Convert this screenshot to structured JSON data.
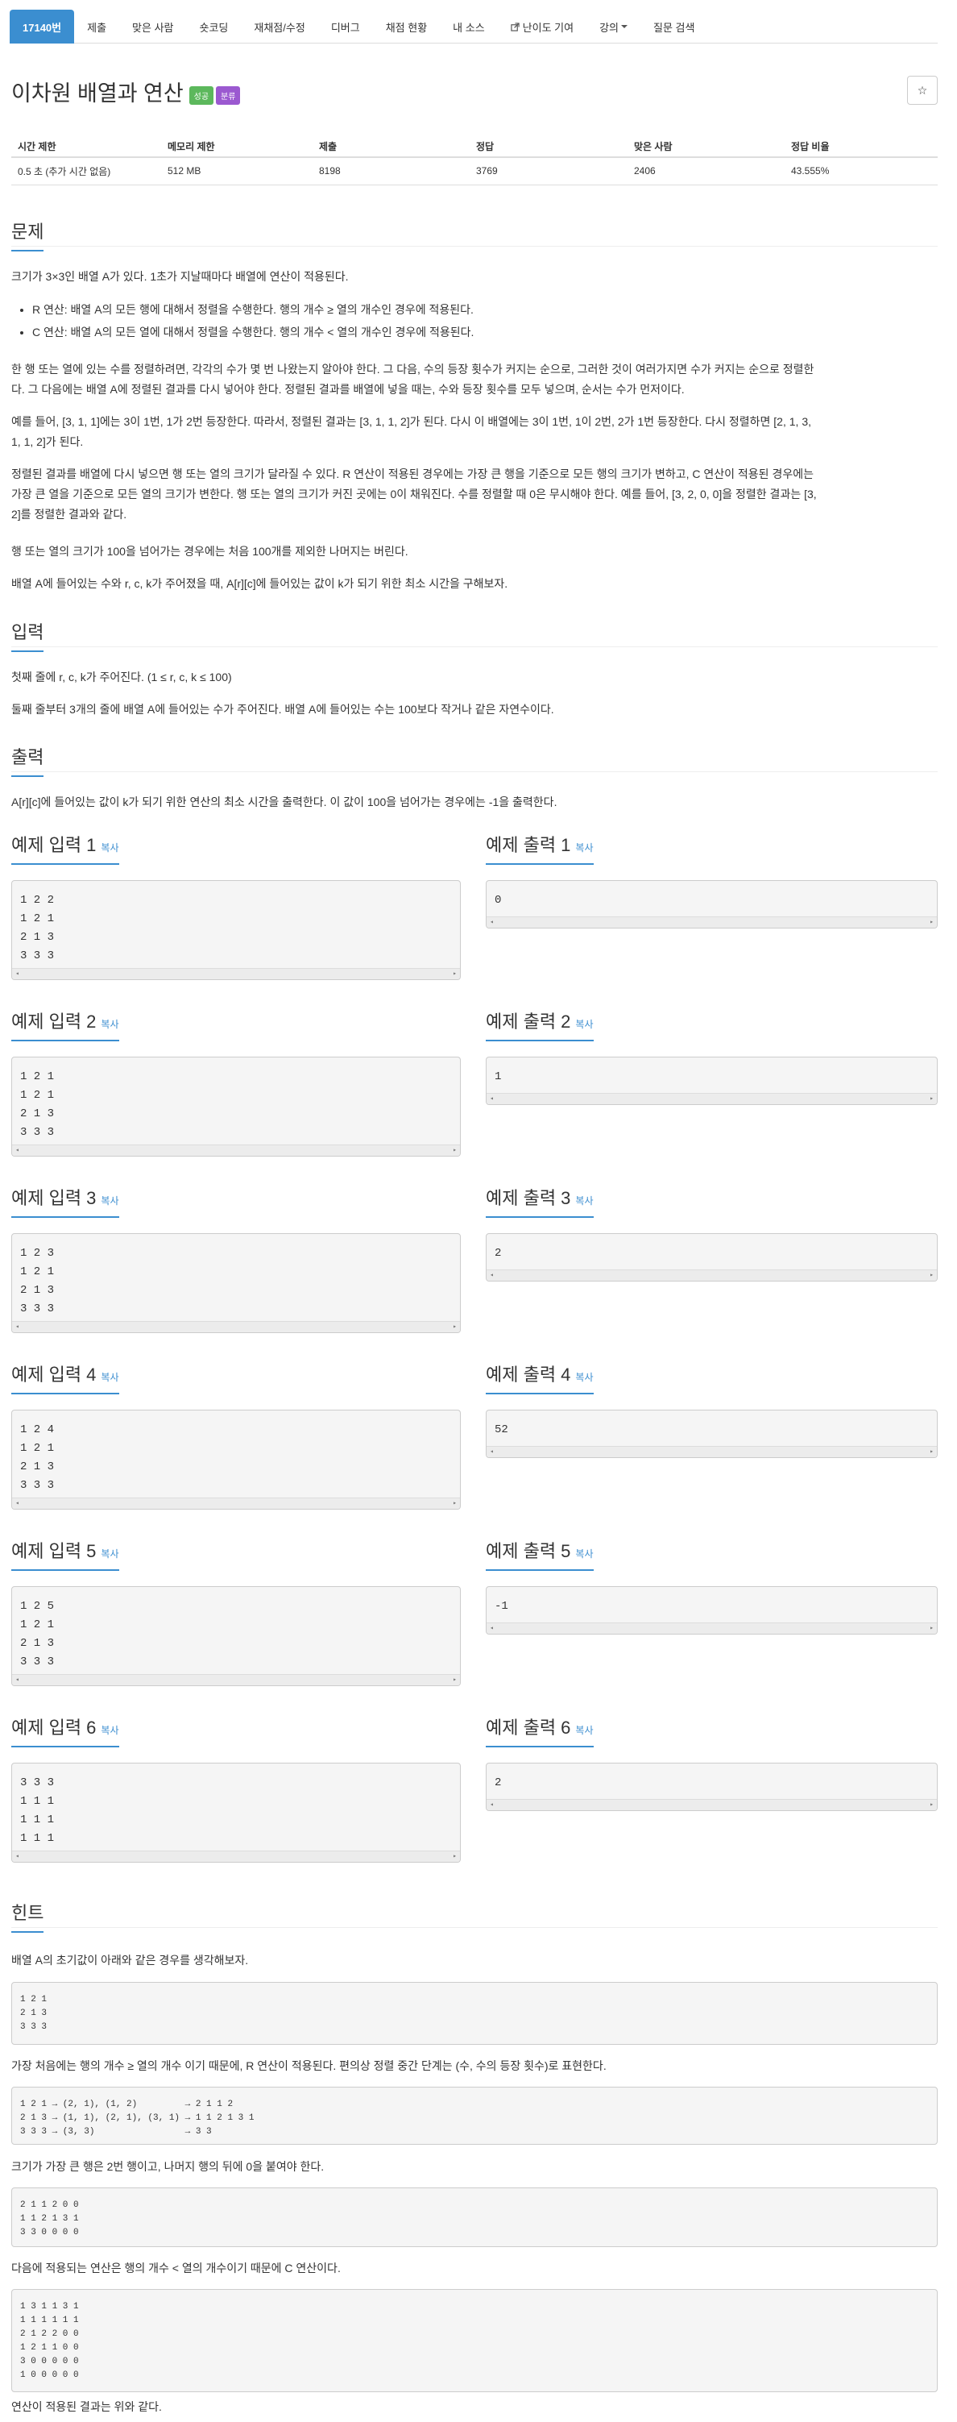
{
  "nav": {
    "problem_no": "17140번",
    "submit": "제출",
    "solvers": "맞은 사람",
    "shortcoding": "숏코딩",
    "rejudge": "재채점/수정",
    "discuss": "디버그",
    "status": "채점 현황",
    "my_source": "내 소스",
    "difficulty": "난이도 기여",
    "lecture": "강의",
    "qna": "질문 검색"
  },
  "problem": {
    "title": "이차원 배열과 연산",
    "badge_success": "성공",
    "badge_category": "분류",
    "star": "☆"
  },
  "info": {
    "headers": [
      "시간 제한",
      "메모리 제한",
      "제출",
      "정답",
      "맞은 사람",
      "정답 비율"
    ],
    "values": [
      "0.5 초 (추가 시간 없음)",
      "512 MB",
      "8198",
      "3769",
      "2406",
      "43.555%"
    ]
  },
  "description": {
    "heading": "문제",
    "p1": "크기가 3×3인 배열 A가 있다. 1초가 지날때마다 배열에 연산이 적용된다.",
    "rules": [
      "R 연산: 배열 A의 모든 행에 대해서 정렬을 수행한다. 행의 개수 ≥ 열의 개수인 경우에 적용된다.",
      "C 연산: 배열 A의 모든 열에 대해서 정렬을 수행한다. 행의 개수 < 열의 개수인 경우에 적용된다."
    ],
    "p2a": "한 행 또는 열에 있는 수를 정렬하려면, 각각의 수가 몇 번 나왔는지 알아야 한다. 그 다음, 수의 등장 횟수가 커지는 순으로, 그러한 것이 여러가지면 수가 커지는 순으로 정렬한",
    "p2b": "다. 그 다음에는 배열 A에 정렬된 결과를 다시 넣어야 한다. 정렬된 결과를 배열에 넣을 때는, 수와 등장 횟수를 모두 넣으며, 순서는 수가 먼저이다.",
    "p3a": "예를 들어, [3, 1, 1]에는 3이 1번, 1가 2번 등장한다. 따라서, 정렬된 결과는 [3, 1, 1, 2]가 된다. 다시 이 배열에는 3이 1번, 1이 2번, 2가 1번 등장한다. 다시 정렬하면 [2, 1, 3,",
    "p3b": "1, 1, 2]가 된다.",
    "p4a": "정렬된 결과를 배열에 다시 넣으면 행 또는 열의 크기가 달라질 수 있다. R 연산이 적용된 경우에는 가장 큰 행을 기준으로 모든 행의 크기가 변하고, C 연산이 적용된 경우에는",
    "p4b": "가장 큰 열을 기준으로 모든 열의 크기가 변한다. 행 또는 열의 크기가 커진 곳에는 0이 채워진다. 수를 정렬할 때 0은 무시해야 한다. 예를 들어, [3, 2, 0, 0]을 정렬한 결과는 [3,",
    "p4c": "2]를 정렬한 결과와 같다.",
    "p5": "행 또는 열의 크기가 100을 넘어가는 경우에는 처음 100개를 제외한 나머지는 버린다.",
    "p6": "배열 A에 들어있는 수와 r, c, k가 주어졌을 때, A[r][c]에 들어있는 값이 k가 되기 위한 최소 시간을 구해보자."
  },
  "input": {
    "heading": "입력",
    "p1": "첫째 줄에 r, c, k가 주어진다. (1 ≤ r, c, k ≤ 100)",
    "p2": "둘째 줄부터 3개의 줄에 배열 A에 들어있는 수가 주어진다. 배열 A에 들어있는 수는 100보다 작거나 같은 자연수이다."
  },
  "output": {
    "heading": "출력",
    "p1": "A[r][c]에 들어있는 값이 k가 되기 위한 연산의 최소 시간을 출력한다. 이 값이 100을 넘어가는 경우에는 -1을 출력한다."
  },
  "copy_label": "복사",
  "examples": [
    {
      "in_title": "예제 입력 1",
      "in": "1 2 2\n1 2 1\n2 1 3\n3 3 3",
      "out_title": "예제 출력 1",
      "out": "0"
    },
    {
      "in_title": "예제 입력 2",
      "in": "1 2 1\n1 2 1\n2 1 3\n3 3 3",
      "out_title": "예제 출력 2",
      "out": "1"
    },
    {
      "in_title": "예제 입력 3",
      "in": "1 2 3\n1 2 1\n2 1 3\n3 3 3",
      "out_title": "예제 출력 3",
      "out": "2"
    },
    {
      "in_title": "예제 입력 4",
      "in": "1 2 4\n1 2 1\n2 1 3\n3 3 3",
      "out_title": "예제 출력 4",
      "out": "52"
    },
    {
      "in_title": "예제 입력 5",
      "in": "1 2 5\n1 2 1\n2 1 3\n3 3 3",
      "out_title": "예제 출력 5",
      "out": "-1"
    },
    {
      "in_title": "예제 입력 6",
      "in": "3 3 3\n1 1 1\n1 1 1\n1 1 1",
      "out_title": "예제 출력 6",
      "out": "2"
    }
  ],
  "hint": {
    "heading": "힌트",
    "p1": "배열 A의 초기값이 아래와 같은 경우를 생각해보자.",
    "pre1": "1 2 1\n2 1 3\n3 3 3",
    "p2": "가장 처음에는 행의 개수 ≥ 열의 개수 이기 때문에, R 연산이 적용된다. 편의상 정렬 중간 단계는 (수, 수의 등장 횟수)로 표현한다.",
    "pre2": "1 2 1 → (2, 1), (1, 2)         → 2 1 1 2\n2 1 3 → (1, 1), (2, 1), (3, 1) → 1 1 2 1 3 1\n3 3 3 → (3, 3)                 → 3 3",
    "p3": "크기가 가장 큰 행은 2번 행이고, 나머지 행의 뒤에 0을 붙여야 한다.",
    "pre3": "2 1 1 2 0 0\n1 1 2 1 3 1\n3 3 0 0 0 0",
    "p4": "다음에 적용되는 연산은 행의 개수 < 열의 개수이기 때문에 C 연산이다.",
    "pre4": "1 3 1 1 3 1\n1 1 1 1 1 1\n2 1 2 2 0 0\n1 2 1 1 0 0\n3 0 0 0 0 0\n1 0 0 0 0 0",
    "p5": "연산이 적용된 결과는 위와 같다."
  }
}
